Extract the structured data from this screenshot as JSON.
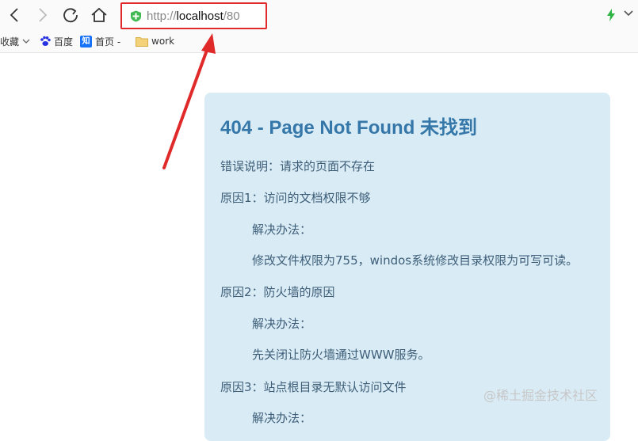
{
  "address_bar": {
    "scheme": "http://",
    "host": "localhost",
    "path": "/80"
  },
  "bookmarks": [
    {
      "label": "收藏",
      "icon": "chevron-down-icon"
    },
    {
      "label": "百度",
      "icon": "baidu-paw-icon"
    },
    {
      "label": "首页 -",
      "icon": "zhihu-icon",
      "icon_text": "知"
    },
    {
      "label": "work",
      "icon": "folder-icon"
    }
  ],
  "error_page": {
    "title": "404 - Page Not Found 未找到",
    "lines": [
      "错误说明：请求的页面不存在",
      "原因1：访问的文档权限不够",
      "解决办法：",
      "修改文件权限为755，windos系统修改目录权限为可写可读。",
      "原因2：防火墙的原因",
      "解决办法：",
      "先关闭让防火墙通过WWW服务。",
      "原因3：站点根目录无默认访问文件",
      "解决办法："
    ]
  },
  "watermark": "@稀土掘金技术社区",
  "colors": {
    "highlight": "#e02a2a",
    "error_box_bg": "#d9ecf6",
    "title_color": "#3577a8"
  }
}
